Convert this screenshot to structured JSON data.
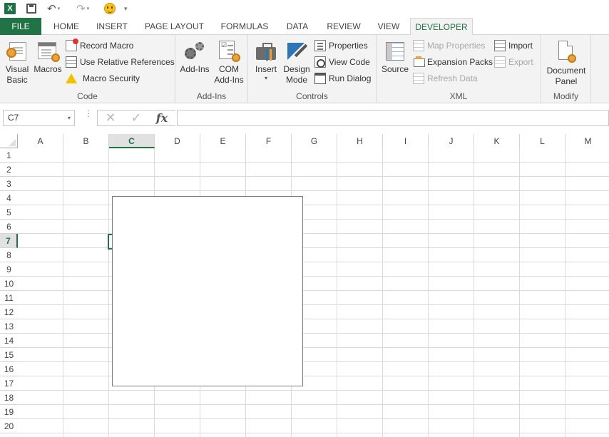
{
  "qat": {
    "logo_letter": "X",
    "undo_arrow": "↶",
    "redo_arrow": "↷",
    "dropdown_arrow": "▾"
  },
  "tabs": [
    "FILE",
    "HOME",
    "INSERT",
    "PAGE LAYOUT",
    "FORMULAS",
    "DATA",
    "REVIEW",
    "VIEW",
    "DEVELOPER"
  ],
  "active_tab": "DEVELOPER",
  "ribbon": {
    "code": {
      "label": "Code",
      "visual_basic": "Visual Basic",
      "macros": "Macros",
      "record_macro": "Record Macro",
      "relative_refs": "Use Relative References",
      "macro_security": "Macro Security"
    },
    "addins": {
      "label": "Add-Ins",
      "addins": "Add-Ins",
      "com_addins": "COM Add-Ins"
    },
    "controls": {
      "label": "Controls",
      "insert": "Insert",
      "insert_arrow": "▾",
      "design_mode": "Design Mode",
      "properties": "Properties",
      "view_code": "View Code",
      "run_dialog": "Run Dialog"
    },
    "xml": {
      "label": "XML",
      "source": "Source",
      "map_properties": "Map Properties",
      "expansion_packs": "Expansion Packs",
      "refresh_data": "Refresh Data",
      "import": "Import",
      "export": "Export"
    },
    "modify": {
      "label": "Modify",
      "document_panel": "Document Panel"
    }
  },
  "formula_bar": {
    "name_box": "C7",
    "name_box_arrow": "▾",
    "cancel_glyph": "✕",
    "enter_glyph": "✓",
    "fx_label": "fx",
    "formula": ""
  },
  "grid": {
    "columns": [
      "A",
      "B",
      "C",
      "D",
      "E",
      "F",
      "G",
      "H",
      "I",
      "J",
      "K",
      "L",
      "M"
    ],
    "rows": [
      "1",
      "2",
      "3",
      "4",
      "5",
      "6",
      "7",
      "8",
      "9",
      "10",
      "11",
      "12",
      "13",
      "14",
      "15",
      "16",
      "17",
      "18",
      "19",
      "20"
    ],
    "selected_column": "C",
    "selected_row": "7"
  },
  "colors": {
    "excel_green": "#217346",
    "file_tab": "#217346",
    "ribbon_bg": "#f3f3f3"
  }
}
